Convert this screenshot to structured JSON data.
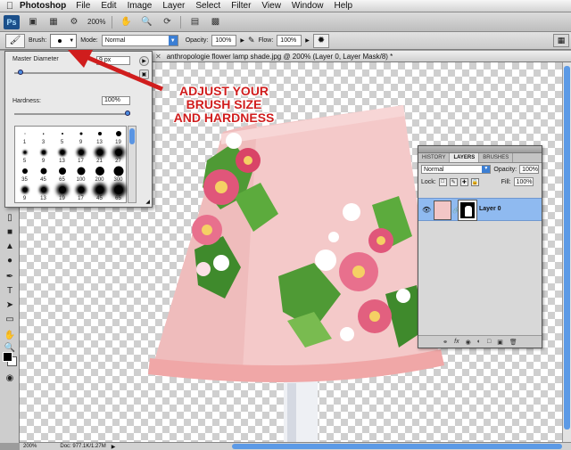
{
  "menubar": {
    "apple_icon": "apple-icon",
    "app_name": "Photoshop",
    "items": [
      "File",
      "Edit",
      "Image",
      "Layer",
      "Select",
      "Filter",
      "View",
      "Window",
      "Help"
    ]
  },
  "appbar": {
    "logo": "Ps",
    "zoom": "200%"
  },
  "options": {
    "brush_label": "Brush:",
    "brush_size": "9",
    "mode_label": "Mode:",
    "mode_value": "Normal",
    "opacity_label": "Opacity:",
    "opacity_value": "100%",
    "flow_label": "Flow:",
    "flow_value": "100%"
  },
  "document": {
    "tab_title": "anthropologie flower lamp shade.jpg @ 200% (Layer 0, Layer Mask/8) *"
  },
  "brush_picker": {
    "master_label": "Master Diameter",
    "master_value": "9 px",
    "hardness_label": "Hardness:",
    "hardness_value": "100%",
    "master_fraction": 0.05,
    "hardness_fraction": 1.0,
    "presets": [
      "1",
      "3",
      "5",
      "9",
      "13",
      "19",
      "5",
      "9",
      "13",
      "17",
      "21",
      "27",
      "35",
      "45",
      "65",
      "100",
      "200",
      "300",
      "9",
      "13",
      "19",
      "17",
      "45",
      "65"
    ]
  },
  "annotation": {
    "lines": [
      "ADJUST YOUR",
      "BRUSH SIZE",
      "AND HARDNESS"
    ],
    "color": "#d01d1d"
  },
  "layers_panel": {
    "tabs": [
      "HISTORY",
      "LAYERS",
      "BRUSHES"
    ],
    "active_tab": "LAYERS",
    "blend_mode": "Normal",
    "opacity_label": "Opacity:",
    "opacity_value": "100%",
    "lock_label": "Lock:",
    "fill_label": "Fill:",
    "fill_value": "100%",
    "layer_name": "Layer 0"
  },
  "status": {
    "zoom": "200%",
    "doc": "Doc: 977.1K/1.27M"
  }
}
